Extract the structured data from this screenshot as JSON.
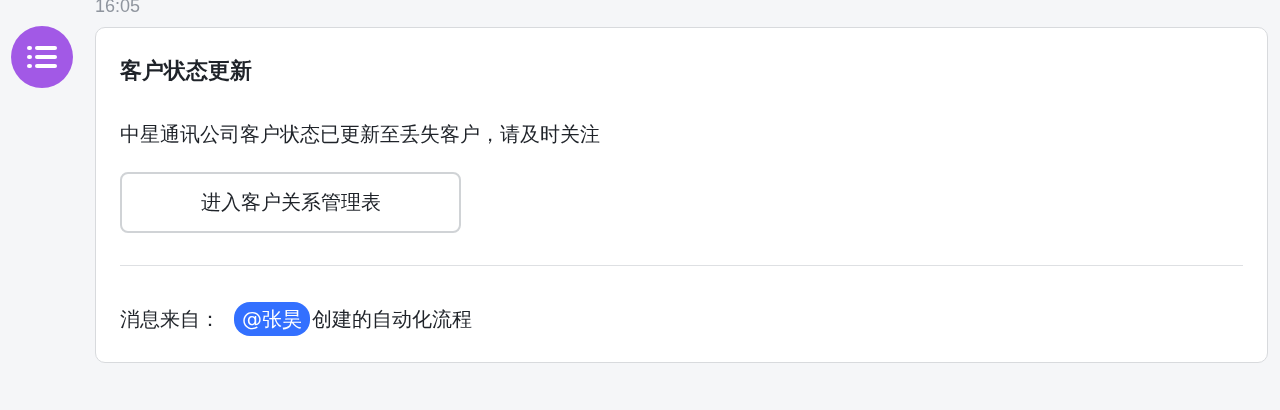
{
  "message": {
    "time": "16:05",
    "card": {
      "title": "客户状态更新",
      "body": "中星通讯公司客户状态已更新至丢失客户，请及时关注",
      "button": "进入客户关系管理表",
      "footer": {
        "label": "消息来自：",
        "mention": "@张昊",
        "suffix": "创建的自动化流程"
      }
    }
  }
}
